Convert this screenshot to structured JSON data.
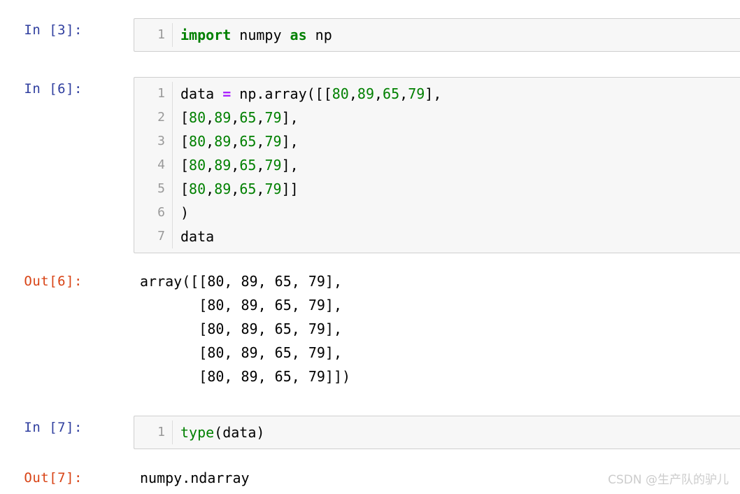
{
  "notebook": {
    "kernel_language": "python",
    "colors": {
      "prompt_in": "#303f9f",
      "prompt_out": "#d84315",
      "cell_background": "#f7f7f7",
      "cell_border": "#cfcfcf",
      "line_number": "#999999",
      "keyword": "#008000",
      "number": "#008000",
      "operator": "#aa22ff",
      "plain_text": "#000000",
      "watermark": "#cccccc"
    },
    "cells": [
      {
        "id": "cell-1",
        "type": "code",
        "prompt": "In [3]:",
        "execution_count": 3,
        "line_numbers": [
          "1"
        ],
        "source": [
          "import numpy as np"
        ],
        "tokens_line_1": {
          "kw_import": "import",
          "mod_numpy": " numpy ",
          "kw_as": "as",
          "alias_np": " np"
        }
      },
      {
        "id": "cell-2",
        "type": "code",
        "prompt": "In [6]:",
        "execution_count": 6,
        "line_numbers": [
          "1",
          "2",
          "3",
          "4",
          "5",
          "6",
          "7"
        ],
        "source": [
          "data = np.array([[80,89,65,79],",
          "[80,89,65,79],",
          "[80,89,65,79],",
          "[80,89,65,79],",
          "[80,89,65,79]]",
          ")",
          "data"
        ],
        "tokens_line_1": {
          "name_data": "data ",
          "op_equals": "=",
          "call_prefix": " np.array([[",
          "n1": "80",
          "c1": ",",
          "n2": "89",
          "c2": ",",
          "n3": "65",
          "c3": ",",
          "n4": "79",
          "tail": "],"
        },
        "row_template": {
          "open": "[",
          "n1": "80",
          "c1": ",",
          "n2": "89",
          "c2": ",",
          "n3": "65",
          "c3": ",",
          "n4": "79",
          "close": "],",
          "close_last": "]]"
        },
        "line_6": ")",
        "line_7": "data"
      },
      {
        "id": "cell-2-output",
        "type": "output",
        "prompt": "Out[6]:",
        "execution_count": 6,
        "output_text": "array([[80, 89, 65, 79],\n       [80, 89, 65, 79],\n       [80, 89, 65, 79],\n       [80, 89, 65, 79],\n       [80, 89, 65, 79]])"
      },
      {
        "id": "cell-3",
        "type": "code",
        "prompt": "In [7]:",
        "execution_count": 7,
        "line_numbers": [
          "1"
        ],
        "source": [
          "type(data)"
        ],
        "tokens_line_1": {
          "bi_type": "type",
          "args": "(data)"
        }
      },
      {
        "id": "cell-3-output",
        "type": "output",
        "prompt": "Out[7]:",
        "execution_count": 7,
        "output_text": "numpy.ndarray"
      }
    ]
  },
  "watermark": {
    "text": "CSDN @生产队的驴儿"
  }
}
